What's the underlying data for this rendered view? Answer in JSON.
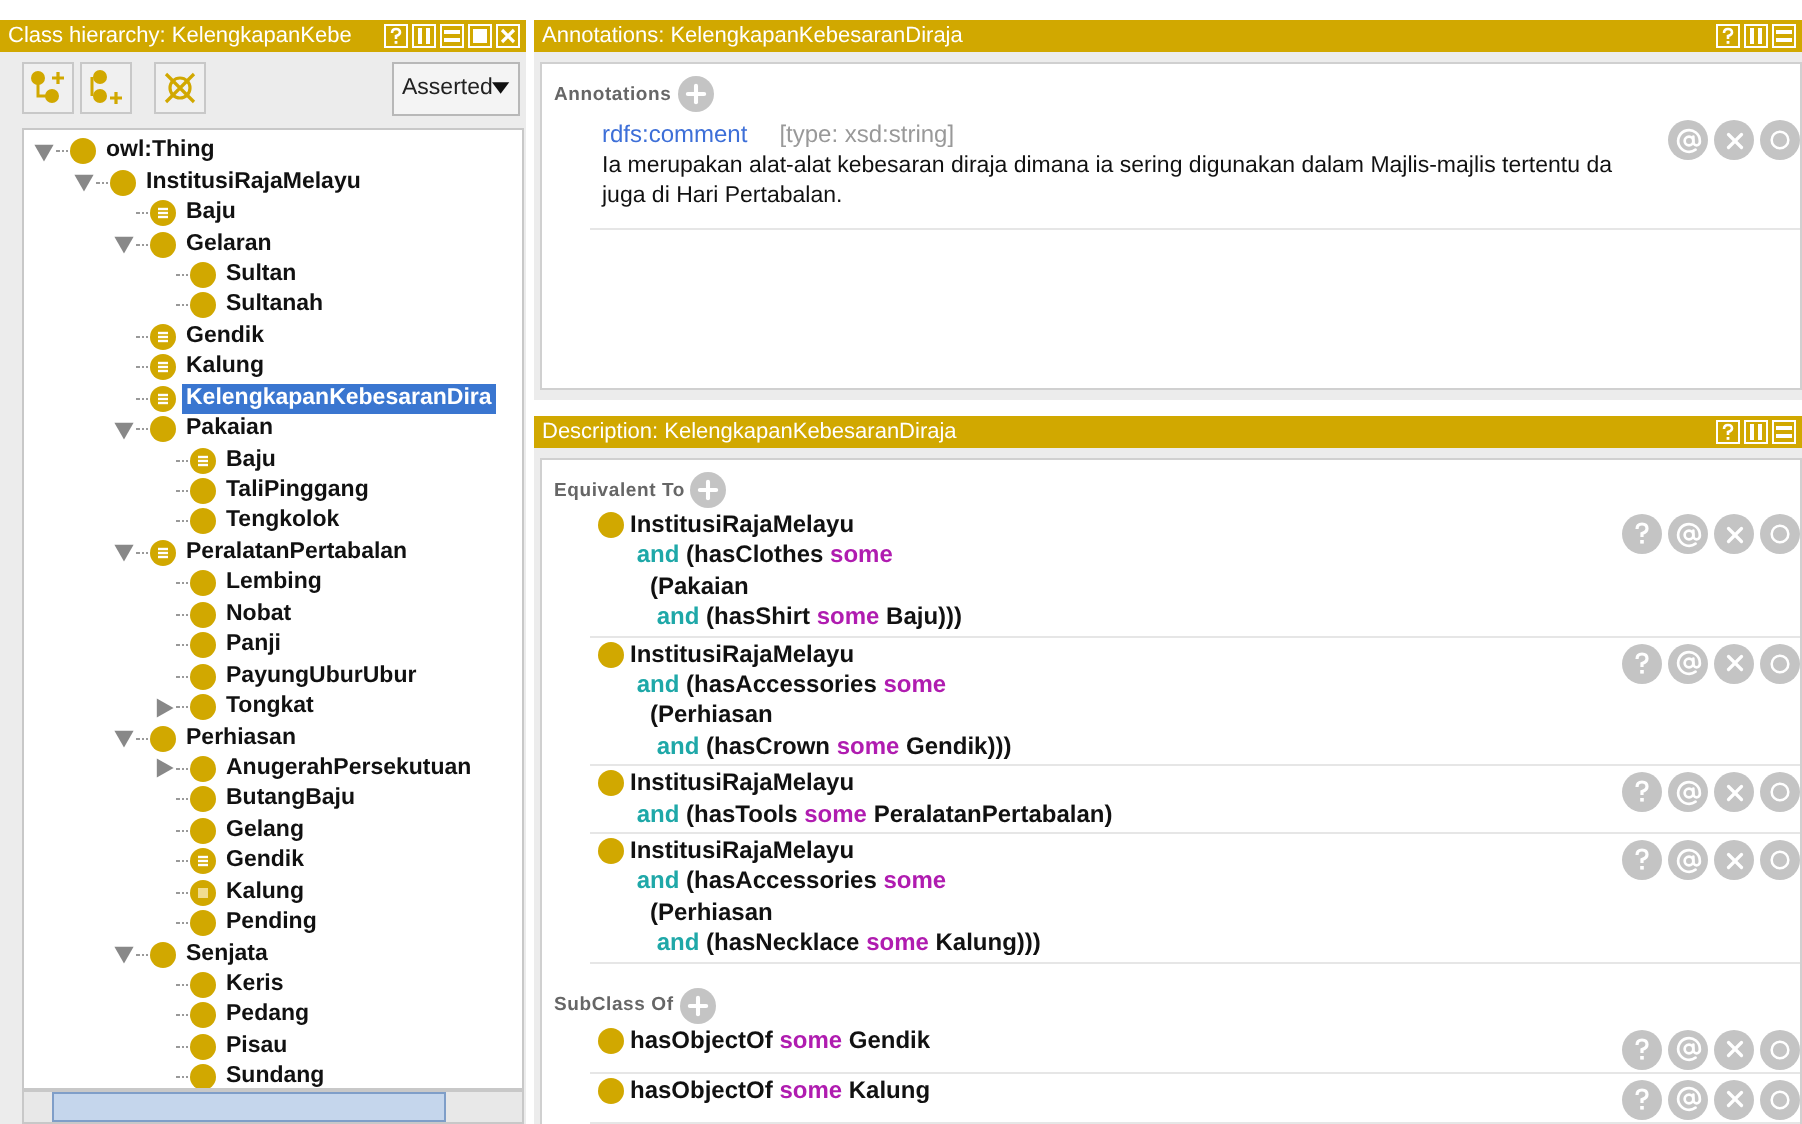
{
  "class_hierarchy": {
    "title": "Class hierarchy: KelengkapanKebe",
    "dropdown": "Asserted",
    "tree": [
      {
        "label": "owl:Thing",
        "kind": "class",
        "selected": false,
        "expanded": true,
        "children": [
          {
            "label": "InstitusiRajaMelayu",
            "kind": "class",
            "selected": false,
            "expanded": true,
            "children": [
              {
                "label": "Baju",
                "kind": "defined",
                "selected": false
              },
              {
                "label": "Gelaran",
                "kind": "class",
                "selected": false,
                "expanded": true,
                "children": [
                  {
                    "label": "Sultan",
                    "kind": "class",
                    "selected": false
                  },
                  {
                    "label": "Sultanah",
                    "kind": "class",
                    "selected": false
                  }
                ]
              },
              {
                "label": "Gendik",
                "kind": "defined",
                "selected": false
              },
              {
                "label": "Kalung",
                "kind": "defined",
                "selected": false
              },
              {
                "label": "KelengkapanKebesaranDira",
                "kind": "defined",
                "selected": true
              },
              {
                "label": "Pakaian",
                "kind": "class",
                "selected": false,
                "expanded": true,
                "children": [
                  {
                    "label": "Baju",
                    "kind": "defined",
                    "selected": false
                  },
                  {
                    "label": "TaliPinggang",
                    "kind": "class",
                    "selected": false
                  },
                  {
                    "label": "Tengkolok",
                    "kind": "class",
                    "selected": false
                  }
                ]
              },
              {
                "label": "PeralatanPertabalan",
                "kind": "defined",
                "selected": false,
                "expanded": true,
                "children": [
                  {
                    "label": "Lembing",
                    "kind": "class",
                    "selected": false
                  },
                  {
                    "label": "Nobat",
                    "kind": "class",
                    "selected": false
                  },
                  {
                    "label": "Panji",
                    "kind": "class",
                    "selected": false
                  },
                  {
                    "label": "PayungUburUbur",
                    "kind": "class",
                    "selected": false
                  },
                  {
                    "label": "Tongkat",
                    "kind": "class",
                    "selected": false,
                    "expanded": false
                  }
                ]
              },
              {
                "label": "Perhiasan",
                "kind": "class",
                "selected": false,
                "expanded": true,
                "children": [
                  {
                    "label": "AnugerahPersekutuan",
                    "kind": "class",
                    "selected": false,
                    "expanded": false
                  },
                  {
                    "label": "ButangBaju",
                    "kind": "class",
                    "selected": false
                  },
                  {
                    "label": "Gelang",
                    "kind": "class",
                    "selected": false
                  },
                  {
                    "label": "Gendik",
                    "kind": "defined",
                    "selected": false
                  },
                  {
                    "label": "Kalung",
                    "kind": "square",
                    "selected": false
                  },
                  {
                    "label": "Pending",
                    "kind": "class",
                    "selected": false
                  }
                ]
              },
              {
                "label": "Senjata",
                "kind": "class",
                "selected": false,
                "expanded": true,
                "children": [
                  {
                    "label": "Keris",
                    "kind": "class",
                    "selected": false
                  },
                  {
                    "label": "Pedang",
                    "kind": "class",
                    "selected": false
                  },
                  {
                    "label": "Pisau",
                    "kind": "class",
                    "selected": false
                  },
                  {
                    "label": "Sundang",
                    "kind": "class",
                    "selected": false
                  }
                ]
              }
            ]
          }
        ]
      }
    ]
  },
  "annotations_panel": {
    "title": "Annotations: KelengkapanKebesaranDiraja",
    "section_label": "Annotations",
    "annotations": [
      {
        "property": "rdfs:comment",
        "type": "[type: xsd:string]",
        "lines": [
          "Ia merupakan alat-alat kebesaran diraja dimana ia sering digunakan dalam Majlis-majlis tertentu da",
          "juga di Hari Pertabalan."
        ]
      }
    ]
  },
  "description_panel": {
    "title": "Description: KelengkapanKebesaranDiraja",
    "sections": [
      {
        "label": "Equivalent To",
        "expressions": [
          {
            "lines": [
              [
                {
                  "kind": "name",
                  "text": "InstitusiRajaMelayu"
                }
              ],
              [
                {
                  "kind": "and",
                  "text": " and"
                },
                {
                  "kind": "name",
                  "text": " (hasClothes "
                },
                {
                  "kind": "some",
                  "text": "some"
                }
              ],
              [
                {
                  "kind": "name",
                  "text": "   (Pakaian"
                }
              ],
              [
                {
                  "kind": "and",
                  "text": "    and"
                },
                {
                  "kind": "name",
                  "text": " (hasShirt "
                },
                {
                  "kind": "some",
                  "text": "some"
                },
                {
                  "kind": "name",
                  "text": " Baju)))"
                }
              ]
            ]
          },
          {
            "lines": [
              [
                {
                  "kind": "name",
                  "text": "InstitusiRajaMelayu"
                }
              ],
              [
                {
                  "kind": "and",
                  "text": " and"
                },
                {
                  "kind": "name",
                  "text": " (hasAccessories "
                },
                {
                  "kind": "some",
                  "text": "some"
                }
              ],
              [
                {
                  "kind": "name",
                  "text": "   (Perhiasan"
                }
              ],
              [
                {
                  "kind": "and",
                  "text": "    and"
                },
                {
                  "kind": "name",
                  "text": " (hasCrown "
                },
                {
                  "kind": "some",
                  "text": "some"
                },
                {
                  "kind": "name",
                  "text": " Gendik)))"
                }
              ]
            ]
          },
          {
            "lines": [
              [
                {
                  "kind": "name",
                  "text": "InstitusiRajaMelayu"
                }
              ],
              [
                {
                  "kind": "and",
                  "text": " and"
                },
                {
                  "kind": "name",
                  "text": " (hasTools "
                },
                {
                  "kind": "some",
                  "text": "some"
                },
                {
                  "kind": "name",
                  "text": " PeralatanPertabalan)"
                }
              ]
            ]
          },
          {
            "lines": [
              [
                {
                  "kind": "name",
                  "text": "InstitusiRajaMelayu"
                }
              ],
              [
                {
                  "kind": "and",
                  "text": " and"
                },
                {
                  "kind": "name",
                  "text": " (hasAccessories "
                },
                {
                  "kind": "some",
                  "text": "some"
                }
              ],
              [
                {
                  "kind": "name",
                  "text": "   (Perhiasan"
                }
              ],
              [
                {
                  "kind": "and",
                  "text": "    and"
                },
                {
                  "kind": "name",
                  "text": " (hasNecklace "
                },
                {
                  "kind": "some",
                  "text": "some"
                },
                {
                  "kind": "name",
                  "text": " Kalung)))"
                }
              ]
            ]
          }
        ]
      },
      {
        "label": "SubClass Of",
        "expressions": [
          {
            "lines": [
              [
                {
                  "kind": "name",
                  "text": "hasObjectOf "
                },
                {
                  "kind": "some",
                  "text": "some"
                },
                {
                  "kind": "name",
                  "text": " Gendik"
                }
              ]
            ]
          },
          {
            "lines": [
              [
                {
                  "kind": "name",
                  "text": "hasObjectOf "
                },
                {
                  "kind": "some",
                  "text": "some"
                },
                {
                  "kind": "name",
                  "text": " Kalung"
                }
              ]
            ]
          }
        ]
      }
    ]
  }
}
